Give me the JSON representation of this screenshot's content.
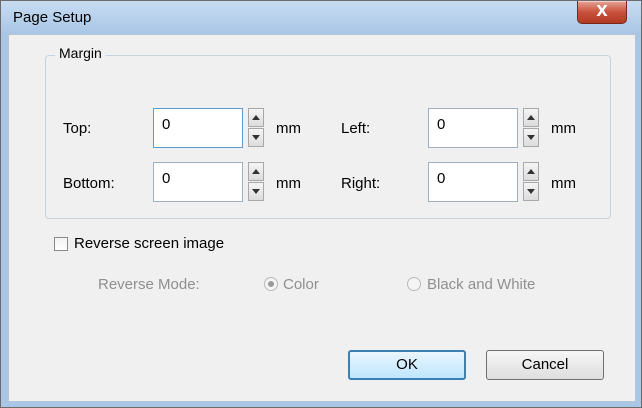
{
  "window": {
    "title": "Page Setup",
    "close_glyph": "X",
    "close_icon": "close-icon"
  },
  "margin": {
    "group_label": "Margin",
    "top": {
      "label": "Top:",
      "value": "0",
      "unit": "mm"
    },
    "bottom": {
      "label": "Bottom:",
      "value": "0",
      "unit": "mm"
    },
    "left": {
      "label": "Left:",
      "value": "0",
      "unit": "mm"
    },
    "right": {
      "label": "Right:",
      "value": "0",
      "unit": "mm"
    }
  },
  "reverse": {
    "checkbox_label": "Reverse screen image",
    "checked": false,
    "mode_label": "Reverse Mode:",
    "options": [
      {
        "label": "Color",
        "selected": true,
        "enabled": false
      },
      {
        "label": "Black and White",
        "selected": false,
        "enabled": false
      }
    ]
  },
  "buttons": {
    "ok": "OK",
    "cancel": "Cancel"
  },
  "colors": {
    "titlebar": "#a9c6e6",
    "close_button": "#c8523d",
    "dialog_background": "#f0f0f0",
    "default_button_border": "#3c7fb1"
  }
}
